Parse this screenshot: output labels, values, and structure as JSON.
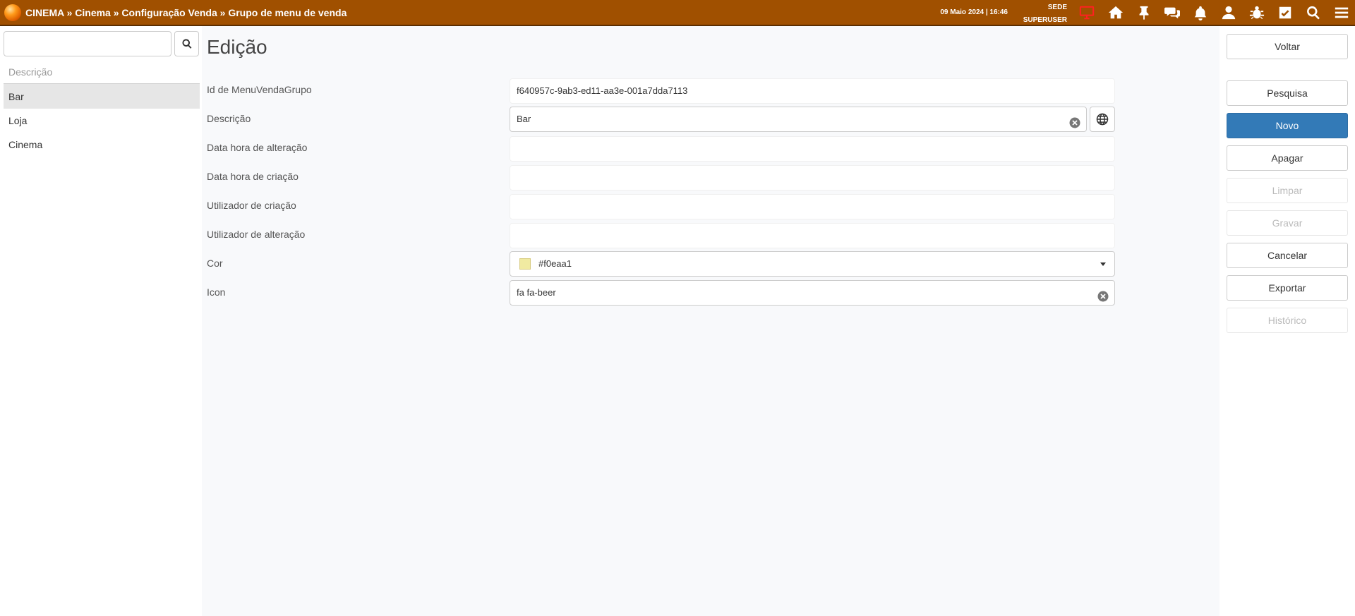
{
  "topbar": {
    "breadcrumb": "CINEMA » Cinema » Configuração Venda » Grupo de menu de venda",
    "datetime": "09 Maio 2024 | 16:46",
    "location": "SEDE",
    "user": "SUPERUSER",
    "icons": [
      "monitor-icon",
      "home-icon",
      "pin-icon",
      "chat-icon",
      "bell-icon",
      "user-icon",
      "bug-icon",
      "checkbox-icon",
      "search-icon",
      "menu-icon"
    ],
    "colors": {
      "bar": "#a05000",
      "monitor_icon": "#ff2020"
    }
  },
  "sidebar": {
    "search": {
      "value": "",
      "placeholder": ""
    },
    "column_header": "Descrição",
    "items": [
      {
        "label": "Bar",
        "selected": true
      },
      {
        "label": "Loja",
        "selected": false
      },
      {
        "label": "Cinema",
        "selected": false
      }
    ]
  },
  "form": {
    "title": "Edição",
    "fields": {
      "id": {
        "label": "Id de MenuVendaGrupo",
        "value": "f640957c-9ab3-ed11-aa3e-001a7dda7113"
      },
      "descricao": {
        "label": "Descrição",
        "value": "Bar"
      },
      "data_alteracao": {
        "label": "Data hora de alteração",
        "value": ""
      },
      "data_criacao": {
        "label": "Data hora de criação",
        "value": ""
      },
      "utilizador_criacao": {
        "label": "Utilizador de criação",
        "value": ""
      },
      "utilizador_alteracao": {
        "label": "Utilizador de alteração",
        "value": ""
      },
      "cor": {
        "label": "Cor",
        "value": "#f0eaa1",
        "swatch_color": "#f0eaa1"
      },
      "icon": {
        "label": "Icon",
        "value": "fa fa-beer"
      }
    }
  },
  "actions": {
    "voltar": "Voltar",
    "pesquisa": "Pesquisa",
    "novo": "Novo",
    "apagar": "Apagar",
    "limpar": "Limpar",
    "gravar": "Gravar",
    "cancelar": "Cancelar",
    "exportar": "Exportar",
    "historico": "Histórico"
  }
}
